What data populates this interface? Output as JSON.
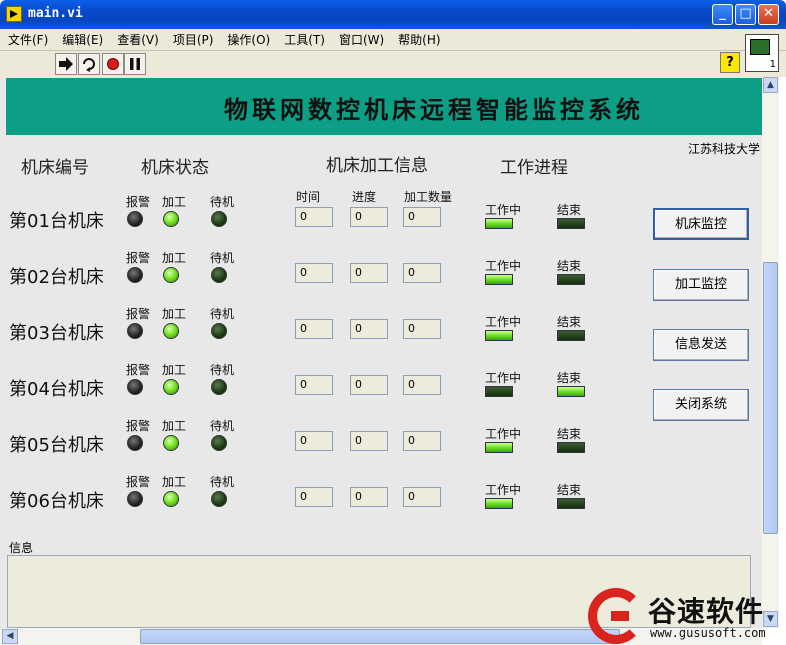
{
  "window": {
    "title": "main.vi",
    "minimize_glyph": "_",
    "maximize_glyph": "□",
    "close_glyph": "✕"
  },
  "menu": [
    "文件(F)",
    "编辑(E)",
    "查看(V)",
    "项目(P)",
    "操作(O)",
    "工具(T)",
    "窗口(W)",
    "帮助(H)"
  ],
  "toolbar": {
    "run_icon": "run-arrow-icon",
    "run_continuous_icon": "run-continuous-icon",
    "abort_icon": "abort-stop-icon",
    "pause_icon": "pause-icon",
    "help_glyph": "?",
    "vi_icon_number": "1"
  },
  "banner": {
    "title": "物联网数控机床远程智能监控系统"
  },
  "university": "江苏科技大学",
  "headers": {
    "machine_no": "机床编号",
    "machine_status": "机床状态",
    "machining_info": "机床加工信息",
    "work_progress": "工作进程"
  },
  "labels": {
    "alarm": "报警",
    "machining": "加工",
    "standby": "待机",
    "time": "时间",
    "progress": "进度",
    "quantity": "加工数量",
    "working": "工作中",
    "finished": "结束"
  },
  "machines": [
    {
      "name": "第01台机床",
      "time": "0",
      "progress": "0",
      "quantity": "0",
      "show_field_labels": true,
      "working": true,
      "finished": false
    },
    {
      "name": "第02台机床",
      "time": "0",
      "progress": "0",
      "quantity": "0",
      "show_field_labels": false,
      "working": true,
      "finished": false
    },
    {
      "name": "第03台机床",
      "time": "0",
      "progress": "0",
      "quantity": "0",
      "show_field_labels": false,
      "working": true,
      "finished": false
    },
    {
      "name": "第04台机床",
      "time": "0",
      "progress": "0",
      "quantity": "0",
      "show_field_labels": false,
      "working": false,
      "finished": true
    },
    {
      "name": "第05台机床",
      "time": "0",
      "progress": "0",
      "quantity": "0",
      "show_field_labels": false,
      "working": true,
      "finished": false
    },
    {
      "name": "第06台机床",
      "time": "0",
      "progress": "0",
      "quantity": "0",
      "show_field_labels": false,
      "working": true,
      "finished": false
    }
  ],
  "buttons": {
    "machine_monitor": "机床监控",
    "machining_monitor": "加工监控",
    "send_info": "信息发送",
    "close_system": "关闭系统"
  },
  "info": {
    "label": "信息",
    "value": ""
  },
  "scroll": {
    "up": "▲",
    "down": "▼",
    "left": "◀",
    "right": "▶",
    "grip": "≡"
  },
  "watermark": {
    "name": "谷速软件",
    "url": "www.gususoft.com"
  },
  "colors": {
    "banner": "#0c9f86",
    "led_on": "#6ee020",
    "titlebar": "#0849c8"
  }
}
